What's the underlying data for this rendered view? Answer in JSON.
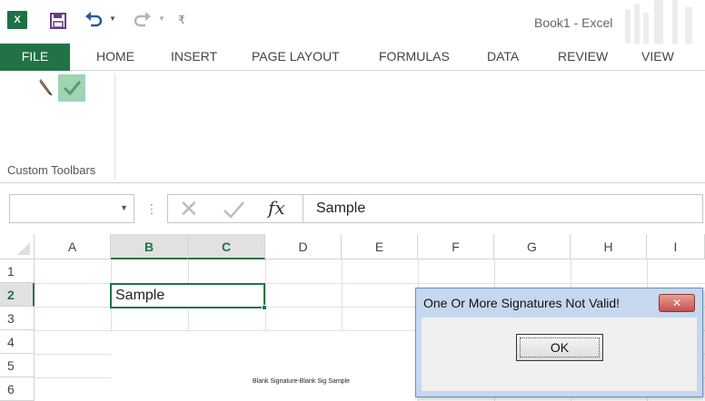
{
  "title_bar": {
    "app_icon": "excel-icon",
    "window_title": "Book1 - Excel",
    "quick_access": [
      "save-icon",
      "undo-icon",
      "redo-icon",
      "customize-icon"
    ]
  },
  "ribbon": {
    "tabs": [
      "FILE",
      "HOME",
      "INSERT",
      "PAGE LAYOUT",
      "FORMULAS",
      "DATA",
      "REVIEW",
      "VIEW"
    ],
    "active_tab": "FILE",
    "group_label": "Custom Toolbars",
    "buttons": [
      "pencil-icon",
      "checkmark-icon"
    ]
  },
  "formula_bar": {
    "name_box": "",
    "fx": "fx",
    "value": "Sample"
  },
  "grid": {
    "columns": [
      "A",
      "B",
      "C",
      "D",
      "E",
      "F",
      "G",
      "H",
      "I"
    ],
    "selected_columns": [
      "B",
      "C"
    ],
    "rows": [
      "1",
      "2",
      "3",
      "4",
      "5",
      "6"
    ],
    "selected_row": "2",
    "cell_B2": "Sample",
    "signature_text": "Blank Signature-Blank Sig Sample"
  },
  "dialog": {
    "title": "One Or More Signatures Not Valid!",
    "close": "✕",
    "ok": "OK"
  },
  "colors": {
    "excel_green": "#217346",
    "dialog_frame": "#c5d8ef",
    "close_red": "#c75050",
    "selected_button": "#9fd5b3"
  }
}
